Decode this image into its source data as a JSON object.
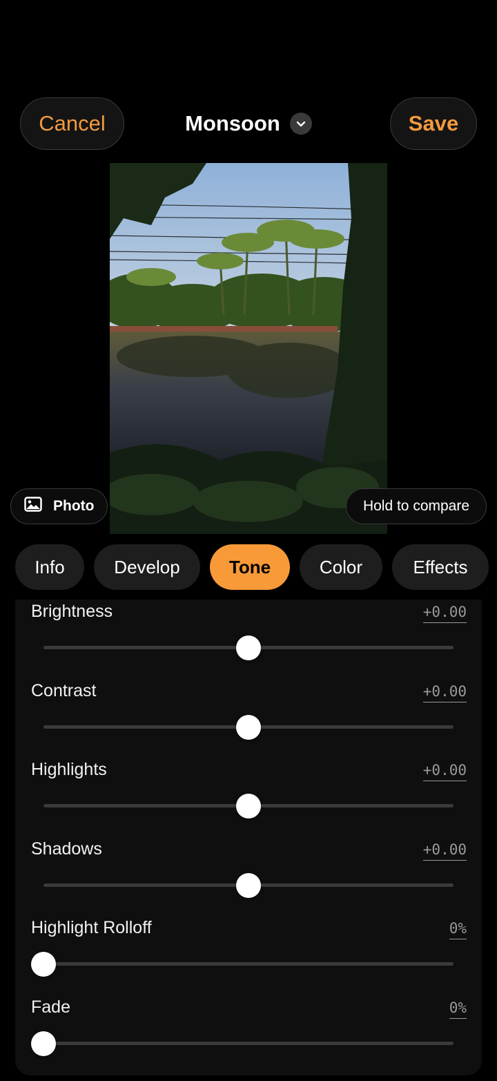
{
  "header": {
    "cancel_label": "Cancel",
    "title": "Monsoon",
    "save_label": "Save"
  },
  "chips": {
    "photo_label": "Photo",
    "compare_label": "Hold to compare"
  },
  "tabs": [
    {
      "label": "Info",
      "active": false
    },
    {
      "label": "Develop",
      "active": false
    },
    {
      "label": "Tone",
      "active": true
    },
    {
      "label": "Color",
      "active": false
    },
    {
      "label": "Effects",
      "active": false
    }
  ],
  "adjustments": [
    {
      "label": "Brightness",
      "value": "+0.00",
      "level": 0.5
    },
    {
      "label": "Contrast",
      "value": "+0.00",
      "level": 0.5
    },
    {
      "label": "Highlights",
      "value": "+0.00",
      "level": 0.5
    },
    {
      "label": "Shadows",
      "value": "+0.00",
      "level": 0.5
    },
    {
      "label": "Highlight Rolloff",
      "value": "0%",
      "level": 0.0
    },
    {
      "label": "Fade",
      "value": "0%",
      "level": 0.0
    }
  ],
  "colors": {
    "accent": "#f89a38",
    "background": "#000000",
    "panel": "#0f0f0f"
  },
  "icons": {
    "title_dropdown": "chevron-down-icon",
    "photo_chip": "image-icon"
  }
}
